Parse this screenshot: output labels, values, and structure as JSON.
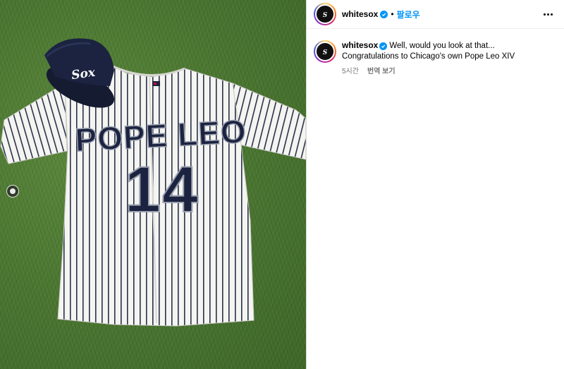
{
  "post": {
    "username": "whitesox",
    "follow_label": "팔로우",
    "separator": "•",
    "caption": "Well, would you look at that... Congratulations to Chicago's own Pope Leo XIV",
    "time_ago": "5시간",
    "translate_label": "번역 보기"
  },
  "image": {
    "jersey_name": "POPE LEO",
    "jersey_number": "14",
    "cap_logo": "Sox"
  },
  "colors": {
    "accent": "#0095f6",
    "navy": "#1b2340",
    "grass": "#4c7832"
  },
  "icons": [
    "verified-badge-icon",
    "more-options-icon",
    "carousel-dot-icon"
  ]
}
